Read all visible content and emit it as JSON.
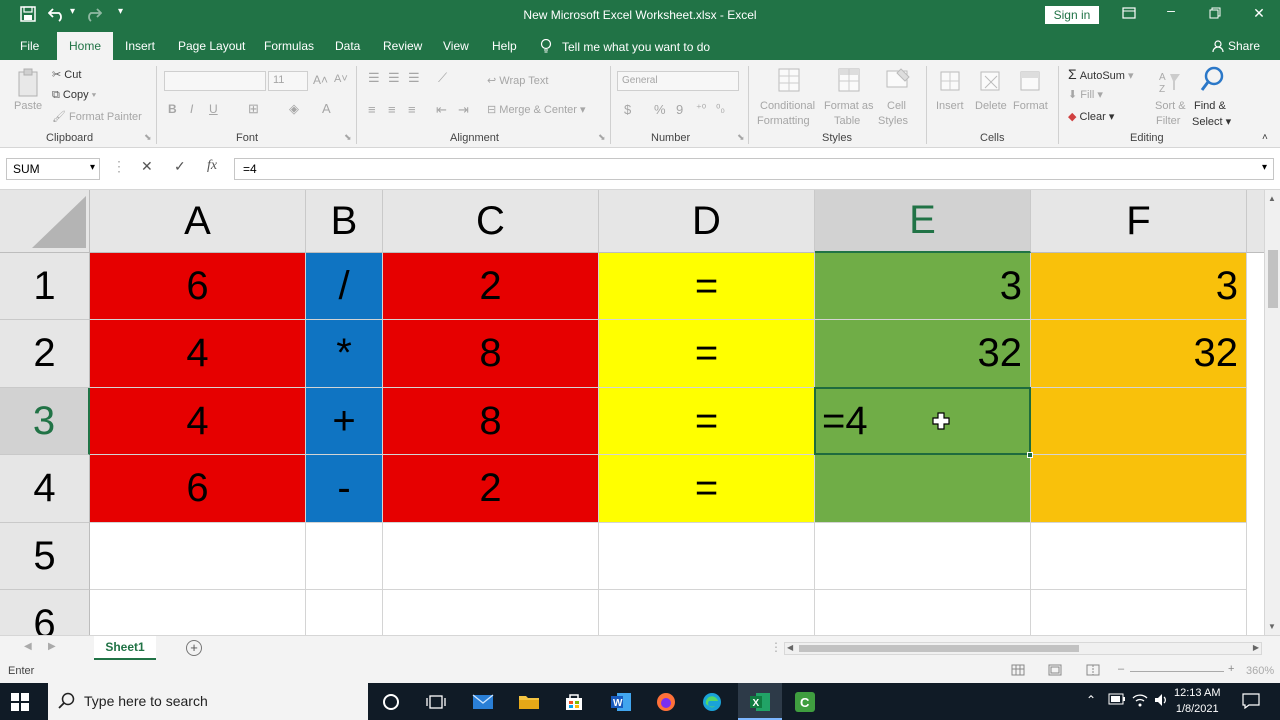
{
  "window": {
    "title": "New Microsoft Excel Worksheet.xlsx  -  Excel",
    "sign_in": "Sign in",
    "minimize_glyph": "🗕",
    "restore_glyph": "🗗",
    "close_glyph": "✕"
  },
  "quick_access": {
    "save_icon": "save-icon",
    "undo_icon": "undo-icon",
    "redo_icon": "redo-icon"
  },
  "ribbon_tabs": [
    {
      "label": "File"
    },
    {
      "label": "Home",
      "active": true
    },
    {
      "label": "Insert"
    },
    {
      "label": "Page Layout"
    },
    {
      "label": "Formulas"
    },
    {
      "label": "Data"
    },
    {
      "label": "Review"
    },
    {
      "label": "View"
    },
    {
      "label": "Help"
    }
  ],
  "tell_me": "Tell me what you want to do",
  "share": "Share",
  "ribbon": {
    "clipboard": {
      "label": "Clipboard",
      "paste": "Paste",
      "cut": "Cut",
      "copy": "Copy",
      "format_painter": "Format Painter"
    },
    "font": {
      "label": "Font",
      "size": "11",
      "bold": "B",
      "italic": "I",
      "underline": "U"
    },
    "alignment": {
      "label": "Alignment",
      "wrap_text": "Wrap Text",
      "merge_center": "Merge & Center"
    },
    "number": {
      "label": "Number",
      "format": "General",
      "currency": "$",
      "percent": "%",
      "comma": "9"
    },
    "styles": {
      "label": "Styles",
      "conditional": "Conditional",
      "formatting": "Formatting",
      "format_as": "Format as",
      "table": "Table",
      "cell": "Cell",
      "cell_styles": "Styles"
    },
    "cells": {
      "label": "Cells",
      "insert": "Insert",
      "delete": "Delete",
      "format": "Format"
    },
    "editing": {
      "label": "Editing",
      "autosum": "AutoSum",
      "fill": "Fill",
      "clear": "Clear",
      "sort": "Sort &",
      "filter": "Filter",
      "find": "Find &",
      "select": "Select"
    }
  },
  "formula_bar": {
    "name_box": "SUM",
    "cancel": "✕",
    "enter": "✓",
    "fx": "fx",
    "value": "=4"
  },
  "columns": [
    "A",
    "B",
    "C",
    "D",
    "E",
    "F"
  ],
  "rows": [
    "1",
    "2",
    "3",
    "4",
    "5",
    "6"
  ],
  "cells": {
    "A1": "6",
    "B1": "/",
    "C1": "2",
    "D1": "=",
    "E1": "3",
    "F1": "3",
    "A2": "4",
    "B2": "*",
    "C2": "8",
    "D2": "=",
    "E2": "32",
    "F2": "32",
    "A3": "4",
    "B3": "+",
    "C3": "8",
    "D3": "=",
    "E3": "=4",
    "F3": "",
    "A4": "6",
    "B4": "-",
    "C4": "2",
    "D4": "=",
    "E4": "",
    "F4": ""
  },
  "colors": {
    "excel_green": "#217346",
    "red": "#e60000",
    "blue": "#0f74c2",
    "yellow": "#ffff00",
    "green": "#70ad47",
    "orange": "#f9c10b"
  },
  "sheet_tab": "Sheet1",
  "status": {
    "mode": "Enter",
    "zoom": "360%"
  },
  "taskbar": {
    "search_placeholder": "Type here to search",
    "time": "12:13 AM",
    "date": "1/8/2021"
  }
}
